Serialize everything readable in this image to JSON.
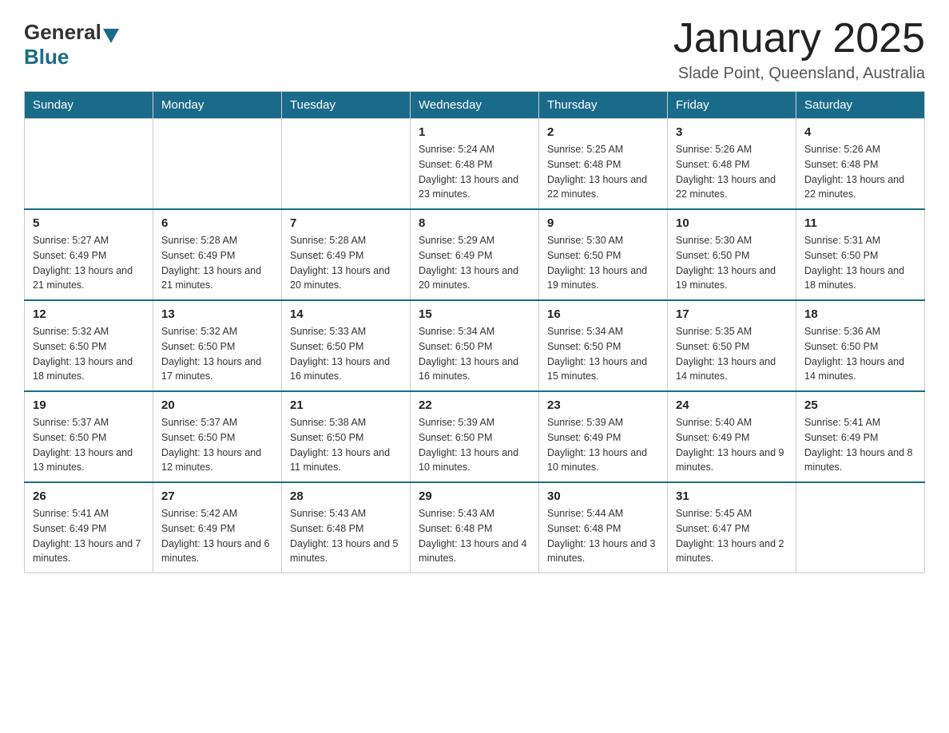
{
  "header": {
    "logo_general": "General",
    "logo_blue": "Blue",
    "month_title": "January 2025",
    "location": "Slade Point, Queensland, Australia"
  },
  "days_of_week": [
    "Sunday",
    "Monday",
    "Tuesday",
    "Wednesday",
    "Thursday",
    "Friday",
    "Saturday"
  ],
  "weeks": [
    [
      {
        "day": "",
        "info": ""
      },
      {
        "day": "",
        "info": ""
      },
      {
        "day": "",
        "info": ""
      },
      {
        "day": "1",
        "info": "Sunrise: 5:24 AM\nSunset: 6:48 PM\nDaylight: 13 hours and 23 minutes."
      },
      {
        "day": "2",
        "info": "Sunrise: 5:25 AM\nSunset: 6:48 PM\nDaylight: 13 hours and 22 minutes."
      },
      {
        "day": "3",
        "info": "Sunrise: 5:26 AM\nSunset: 6:48 PM\nDaylight: 13 hours and 22 minutes."
      },
      {
        "day": "4",
        "info": "Sunrise: 5:26 AM\nSunset: 6:48 PM\nDaylight: 13 hours and 22 minutes."
      }
    ],
    [
      {
        "day": "5",
        "info": "Sunrise: 5:27 AM\nSunset: 6:49 PM\nDaylight: 13 hours and 21 minutes."
      },
      {
        "day": "6",
        "info": "Sunrise: 5:28 AM\nSunset: 6:49 PM\nDaylight: 13 hours and 21 minutes."
      },
      {
        "day": "7",
        "info": "Sunrise: 5:28 AM\nSunset: 6:49 PM\nDaylight: 13 hours and 20 minutes."
      },
      {
        "day": "8",
        "info": "Sunrise: 5:29 AM\nSunset: 6:49 PM\nDaylight: 13 hours and 20 minutes."
      },
      {
        "day": "9",
        "info": "Sunrise: 5:30 AM\nSunset: 6:50 PM\nDaylight: 13 hours and 19 minutes."
      },
      {
        "day": "10",
        "info": "Sunrise: 5:30 AM\nSunset: 6:50 PM\nDaylight: 13 hours and 19 minutes."
      },
      {
        "day": "11",
        "info": "Sunrise: 5:31 AM\nSunset: 6:50 PM\nDaylight: 13 hours and 18 minutes."
      }
    ],
    [
      {
        "day": "12",
        "info": "Sunrise: 5:32 AM\nSunset: 6:50 PM\nDaylight: 13 hours and 18 minutes."
      },
      {
        "day": "13",
        "info": "Sunrise: 5:32 AM\nSunset: 6:50 PM\nDaylight: 13 hours and 17 minutes."
      },
      {
        "day": "14",
        "info": "Sunrise: 5:33 AM\nSunset: 6:50 PM\nDaylight: 13 hours and 16 minutes."
      },
      {
        "day": "15",
        "info": "Sunrise: 5:34 AM\nSunset: 6:50 PM\nDaylight: 13 hours and 16 minutes."
      },
      {
        "day": "16",
        "info": "Sunrise: 5:34 AM\nSunset: 6:50 PM\nDaylight: 13 hours and 15 minutes."
      },
      {
        "day": "17",
        "info": "Sunrise: 5:35 AM\nSunset: 6:50 PM\nDaylight: 13 hours and 14 minutes."
      },
      {
        "day": "18",
        "info": "Sunrise: 5:36 AM\nSunset: 6:50 PM\nDaylight: 13 hours and 14 minutes."
      }
    ],
    [
      {
        "day": "19",
        "info": "Sunrise: 5:37 AM\nSunset: 6:50 PM\nDaylight: 13 hours and 13 minutes."
      },
      {
        "day": "20",
        "info": "Sunrise: 5:37 AM\nSunset: 6:50 PM\nDaylight: 13 hours and 12 minutes."
      },
      {
        "day": "21",
        "info": "Sunrise: 5:38 AM\nSunset: 6:50 PM\nDaylight: 13 hours and 11 minutes."
      },
      {
        "day": "22",
        "info": "Sunrise: 5:39 AM\nSunset: 6:50 PM\nDaylight: 13 hours and 10 minutes."
      },
      {
        "day": "23",
        "info": "Sunrise: 5:39 AM\nSunset: 6:49 PM\nDaylight: 13 hours and 10 minutes."
      },
      {
        "day": "24",
        "info": "Sunrise: 5:40 AM\nSunset: 6:49 PM\nDaylight: 13 hours and 9 minutes."
      },
      {
        "day": "25",
        "info": "Sunrise: 5:41 AM\nSunset: 6:49 PM\nDaylight: 13 hours and 8 minutes."
      }
    ],
    [
      {
        "day": "26",
        "info": "Sunrise: 5:41 AM\nSunset: 6:49 PM\nDaylight: 13 hours and 7 minutes."
      },
      {
        "day": "27",
        "info": "Sunrise: 5:42 AM\nSunset: 6:49 PM\nDaylight: 13 hours and 6 minutes."
      },
      {
        "day": "28",
        "info": "Sunrise: 5:43 AM\nSunset: 6:48 PM\nDaylight: 13 hours and 5 minutes."
      },
      {
        "day": "29",
        "info": "Sunrise: 5:43 AM\nSunset: 6:48 PM\nDaylight: 13 hours and 4 minutes."
      },
      {
        "day": "30",
        "info": "Sunrise: 5:44 AM\nSunset: 6:48 PM\nDaylight: 13 hours and 3 minutes."
      },
      {
        "day": "31",
        "info": "Sunrise: 5:45 AM\nSunset: 6:47 PM\nDaylight: 13 hours and 2 minutes."
      },
      {
        "day": "",
        "info": ""
      }
    ]
  ]
}
